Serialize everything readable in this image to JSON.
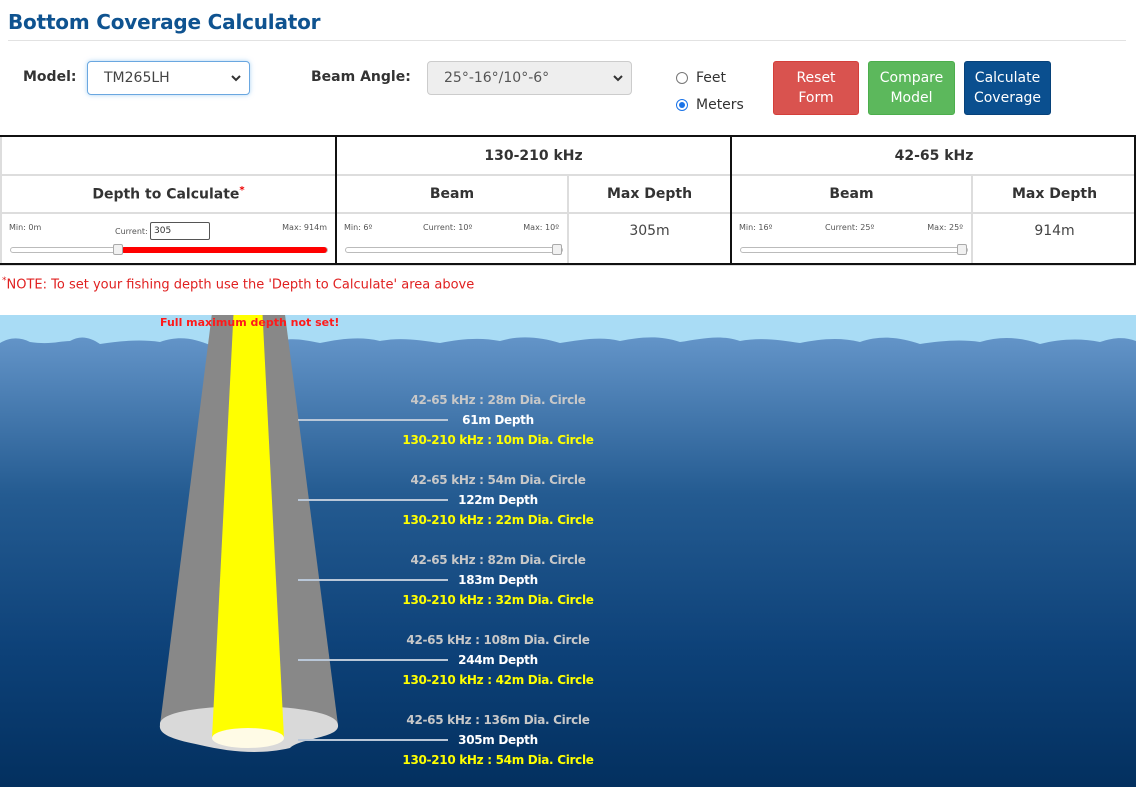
{
  "page": {
    "title": "Bottom Coverage Calculator"
  },
  "form": {
    "model_label": "Model:",
    "model_value": "TM265LH",
    "beam_angle_label": "Beam Angle:",
    "beam_angle_value": "25°-16°/10°-6°",
    "units": [
      {
        "label": "Feet",
        "selected": false
      },
      {
        "label": "Meters",
        "selected": true
      }
    ],
    "buttons": {
      "reset_line1": "Reset",
      "reset_line2": "Form",
      "compare_line1": "Compare",
      "compare_line2": "Model",
      "calculate_line1": "Calculate",
      "calculate_line2": "Coverage"
    },
    "colors": {
      "reset": "#d9534f",
      "compare": "#5cb85c",
      "calculate": "#0a4f8f",
      "title": "#0f5390"
    }
  },
  "table": {
    "freq_high": "130-210 kHz",
    "freq_low": "42-65 kHz",
    "depth_header": "Depth to Calculate",
    "required_mark": "*",
    "beam_header": "Beam",
    "max_depth_header": "Max Depth",
    "depth": {
      "min_label": "Min: 0m",
      "current_label": "Current:",
      "current_value": "305",
      "max_label": "Max: 914m",
      "min": 0,
      "max": 914,
      "value": 305
    },
    "high_beam": {
      "min_label": "Min: 6º",
      "current_label": "Current: 10º",
      "max_label": "Max: 10º",
      "min": 6,
      "max": 10,
      "value": 10,
      "max_depth": "305m"
    },
    "low_beam": {
      "min_label": "Min: 16º",
      "current_label": "Current: 25º",
      "max_label": "Max: 25º",
      "min": 16,
      "max": 25,
      "value": 25,
      "max_depth": "914m"
    }
  },
  "note": {
    "star": "*",
    "text": "NOTE: To set your fishing depth use the 'Depth to Calculate' area above"
  },
  "diagram": {
    "warning": "Full maximum depth not set!",
    "levels": [
      {
        "wide": "42-65 kHz : 28m Dia. Circle",
        "depth": "61m Depth",
        "narrow": "130-210 kHz : 10m Dia. Circle"
      },
      {
        "wide": "42-65 kHz : 54m Dia. Circle",
        "depth": "122m Depth",
        "narrow": "130-210 kHz : 22m Dia. Circle"
      },
      {
        "wide": "42-65 kHz : 82m Dia. Circle",
        "depth": "183m Depth",
        "narrow": "130-210 kHz : 32m Dia. Circle"
      },
      {
        "wide": "42-65 kHz : 108m Dia. Circle",
        "depth": "244m Depth",
        "narrow": "130-210 kHz : 42m Dia. Circle"
      },
      {
        "wide": "42-65 kHz : 136m Dia. Circle",
        "depth": "305m Depth",
        "narrow": "130-210 kHz : 54m Dia. Circle"
      }
    ],
    "colors": {
      "wide_beam": "#888888",
      "narrow_beam": "#ffff00",
      "sky": "#a9dcf5",
      "water_top": "#6394c8",
      "water_bottom": "#03305f",
      "warning": "#ff1a1a"
    }
  }
}
